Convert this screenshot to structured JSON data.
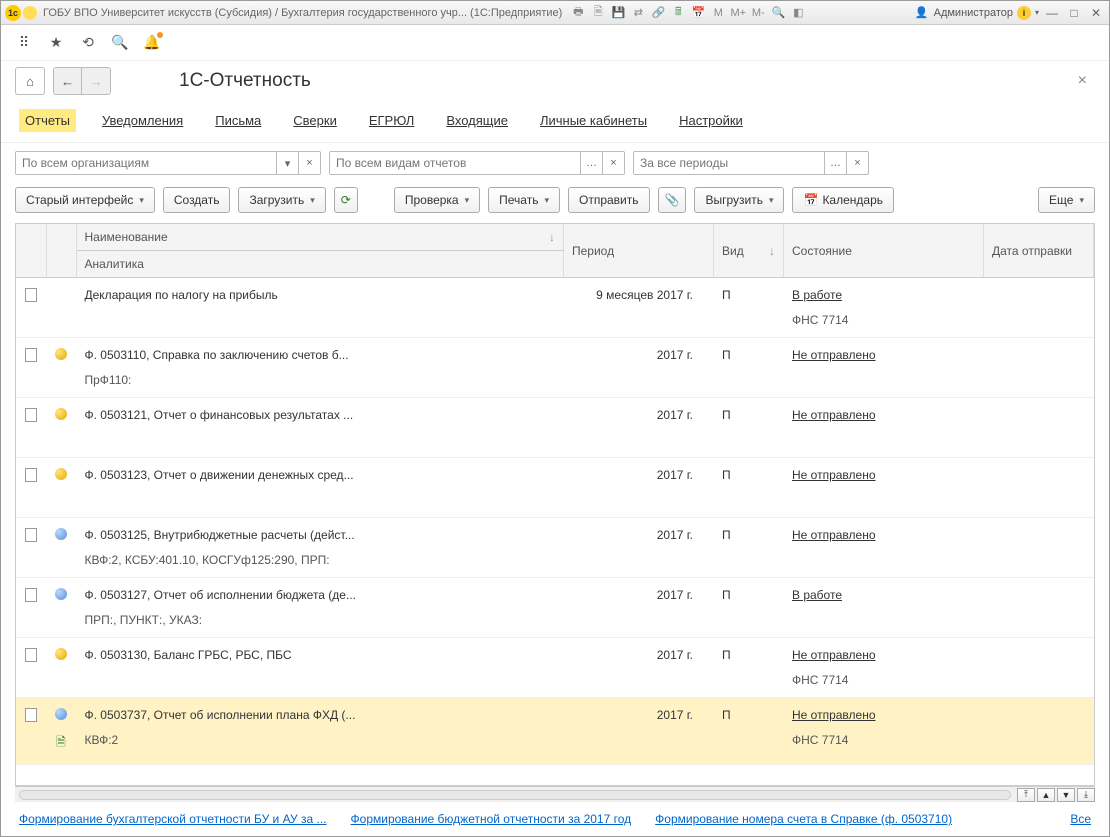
{
  "titlebar": {
    "logo_text": "1c",
    "title": "ГОБУ ВПО Университет искусств (Субсидия) / Бухгалтерия государственного учр...  (1С:Предприятие)",
    "user": "Администратор",
    "m_labels": [
      "M",
      "M+",
      "M-"
    ]
  },
  "page": {
    "title": "1С-Отчетность"
  },
  "tabs": [
    {
      "label": "Отчеты",
      "active": true
    },
    {
      "label": "Уведомления"
    },
    {
      "label": "Письма"
    },
    {
      "label": "Сверки"
    },
    {
      "label": "ЕГРЮЛ"
    },
    {
      "label": "Входящие"
    },
    {
      "label": "Личные кабинеты"
    },
    {
      "label": "Настройки"
    }
  ],
  "filters": {
    "org_placeholder": "По всем организациям",
    "type_placeholder": "По всем видам отчетов",
    "period_placeholder": "За все периоды"
  },
  "actions": {
    "old_ui": "Старый интерфейс",
    "create": "Создать",
    "load": "Загрузить",
    "check": "Проверка",
    "print": "Печать",
    "send": "Отправить",
    "export": "Выгрузить",
    "calendar": "Календарь",
    "more": "Еще"
  },
  "columns": {
    "name": "Наименование",
    "analytics": "Аналитика",
    "period": "Период",
    "kind": "Вид",
    "status": "Состояние",
    "sent_date": "Дата отправки"
  },
  "rows": [
    {
      "icon": "doc",
      "dot": "",
      "name": "Декларация по налогу на прибыль",
      "analytics": "",
      "period": "9 месяцев 2017 г.",
      "kind": "П",
      "status": "В работе",
      "sub_status": "ФНС 7714"
    },
    {
      "icon": "doc",
      "dot": "yellow",
      "name": "Ф. 0503110, Справка по заключению счетов б...",
      "analytics": "ПрФ110:",
      "period": "2017 г.",
      "kind": "П",
      "status": "Не отправлено",
      "sub_status": ""
    },
    {
      "icon": "doc",
      "dot": "yellow",
      "name": "Ф. 0503121, Отчет о финансовых результатах ...",
      "analytics": "",
      "period": "2017 г.",
      "kind": "П",
      "status": "Не отправлено",
      "sub_status": ""
    },
    {
      "icon": "doc",
      "dot": "yellow",
      "name": "Ф. 0503123, Отчет о движении денежных сред...",
      "analytics": "",
      "period": "2017 г.",
      "kind": "П",
      "status": "Не отправлено",
      "sub_status": ""
    },
    {
      "icon": "doc",
      "dot": "blue",
      "name": "Ф. 0503125, Внутрибюджетные расчеты (дейст...",
      "analytics": "КВФ:2, КСБУ:401.10, КОСГУф125:290, ПРП:",
      "period": "2017 г.",
      "kind": "П",
      "status": "Не отправлено",
      "sub_status": ""
    },
    {
      "icon": "doc",
      "dot": "blue",
      "name": "Ф. 0503127, Отчет об исполнении бюджета (де...",
      "analytics": "ПРП:, ПУНКТ:, УКАЗ:",
      "period": "2017 г.",
      "kind": "П",
      "status": "В работе",
      "sub_status": ""
    },
    {
      "icon": "doc",
      "dot": "yellow",
      "name": "Ф. 0503130, Баланс ГРБС, РБС, ПБС",
      "analytics": "",
      "period": "2017 г.",
      "kind": "П",
      "status": "Не отправлено",
      "sub_status": "ФНС 7714"
    },
    {
      "icon": "doc",
      "dot": "blue",
      "name": "Ф. 0503737, Отчет об исполнении плана ФХД (...",
      "analytics": "КВФ:2",
      "period": "2017 г.",
      "kind": "П",
      "status": "Не отправлено",
      "sub_status": "ФНС 7714",
      "selected": true
    }
  ],
  "footer": {
    "link1": "Формирование бухгалтерской отчетности БУ и АУ за ...",
    "link2": "Формирование бюджетной отчетности за 2017 год",
    "link3": "Формирование номера счета в Справке (ф. 0503710)",
    "all": "Все"
  }
}
